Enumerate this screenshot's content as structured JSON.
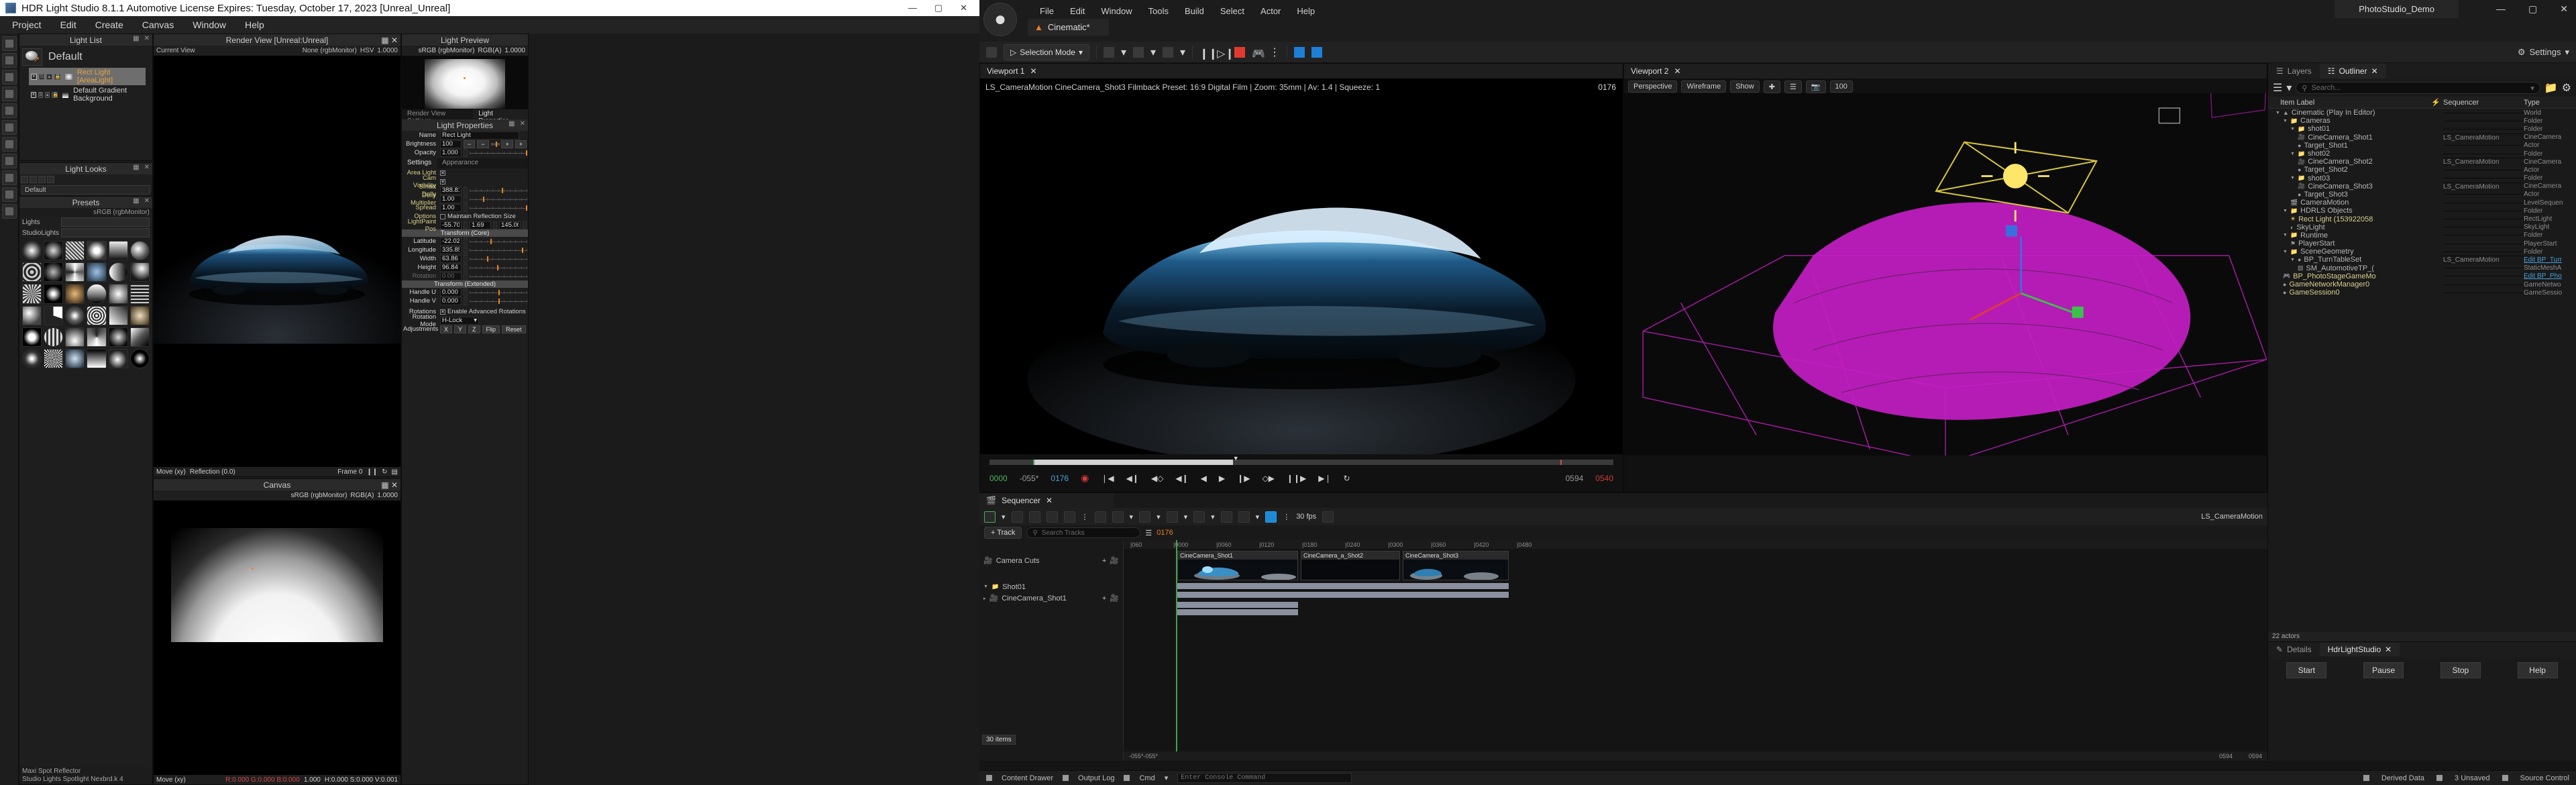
{
  "hdrls": {
    "title": "HDR Light Studio 8.1.1  Automotive License Expires: Tuesday, October 17, 2023  [Unreal_Unreal]",
    "window_buttons": [
      "—",
      "▢",
      "✕"
    ],
    "menu": [
      "Project",
      "Edit",
      "Create",
      "Canvas",
      "Window",
      "Help"
    ],
    "light_list": {
      "title": "Light List",
      "default_label": "Default",
      "items": [
        {
          "name": "Rect Light [AreaLight]",
          "selected": true
        },
        {
          "name": "Default Gradient Background",
          "selected": false
        }
      ]
    },
    "light_looks": {
      "title": "Light Looks",
      "slot": "Default"
    },
    "presets": {
      "title": "Presets",
      "colorspace": "sRGB (rgbMonitor)",
      "rows": [
        {
          "label": "Lights",
          "value": ""
        },
        {
          "label": "StudioLights",
          "value": ""
        }
      ],
      "footer_lines": [
        "Maxi Spot Reflector",
        "Studio Lights Spotlight Nexbrd.k 4"
      ]
    },
    "render_view": {
      "title": "Render View [Unreal:Unreal]",
      "bar_left": "Current View",
      "bar_mid": "None (rgbMonitor)",
      "bar_color": "HSV",
      "bar_value": "1.0000",
      "foot_move": "Move (xy)",
      "foot_reflect": "Reflection (0.0)",
      "foot_frame": "Frame 0"
    },
    "canvas": {
      "title": "Canvas",
      "colorspace": "sRGB (rgbMonitor)",
      "value": "1.0000",
      "foot_move": "Move (xy)",
      "readout_left": "R:0.000 G:0.000 B:0.000",
      "readout_exp": "1.000",
      "readout_right": "H:0.000 S:0.000 V:0.001"
    },
    "light_preview": {
      "title": "Light Preview",
      "colorspace": "sRGB (rgbMonitor)",
      "channel": "RGB(A)",
      "value": "1.0000"
    },
    "light_properties": {
      "tabs": [
        "Render View Settings",
        "Light Properties"
      ],
      "active_tab": "Light Properties",
      "panel_title": "Light Properties",
      "name_label": "Name",
      "name_value": "Rect Light",
      "brightness_label": "Brightness",
      "brightness_value": "100",
      "opacity_label": "Opacity",
      "opacity_value": "1.000",
      "sub_tabs": [
        "Settings",
        "Appearance"
      ],
      "sub_active": "Settings",
      "settings": [
        {
          "label": "Area Light",
          "type": "check",
          "checked": true
        },
        {
          "label": "Cam Visibility",
          "type": "check",
          "checked": true
        },
        {
          "label": "Smart Dolly",
          "type": "slider",
          "value": "388.81",
          "knob": 57
        },
        {
          "label": "Dolly Multiplier",
          "type": "slider",
          "value": "1.00",
          "knob": 24
        },
        {
          "label": "Spread",
          "type": "slider",
          "value": "1.00",
          "knob": 99
        }
      ],
      "options_label": "Options",
      "options_check": "Maintain Reflection Size",
      "options_checked": false,
      "lightpaint_label": "LightPaint Pos",
      "lightpaint": [
        "-55.70",
        "1.69",
        "145.00"
      ],
      "transform_core_title": "Transform (Core)",
      "transform_core": [
        {
          "label": "Latitude",
          "value": "-22.02",
          "knob": 37
        },
        {
          "label": "Longitude",
          "value": "335.85",
          "knob": 92
        },
        {
          "label": "Width",
          "value": "63.86",
          "knob": 31
        },
        {
          "label": "Height",
          "value": "96.84",
          "knob": 48
        },
        {
          "label": "Rotation",
          "value": "0.00",
          "knob": 0,
          "disabled": true
        }
      ],
      "transform_ext_title": "Transform (Extended)",
      "transform_ext": [
        {
          "label": "Handle U",
          "value": "0.000",
          "knob": 50
        },
        {
          "label": "Handle V",
          "value": "0.000",
          "knob": 50
        }
      ],
      "rotations_label": "Rotations",
      "rotations_check": "Enable Advanced Rotations",
      "rotations_checked": true,
      "rotation_mode_label": "Rotation Mode",
      "rotation_mode_value": "H-Lock",
      "adjustments_label": "Adjustments",
      "adjust_buttons": [
        "X",
        "Y",
        "Z",
        "Flip",
        "Reset"
      ]
    }
  },
  "unreal": {
    "menu": [
      "File",
      "Edit",
      "Window",
      "Tools",
      "Build",
      "Select",
      "Actor",
      "Help"
    ],
    "tab_label": "Cinematic*",
    "project_tab": "PhotoStudio_Demo",
    "window_buttons": [
      "—",
      "▢",
      "✕"
    ],
    "toolbar": {
      "selection_mode": "Selection Mode",
      "settings": "Settings"
    },
    "viewports": [
      {
        "tab": "Viewport 1",
        "stats": "LS_CameraMotion CineCamera_Shot3  Filmback Preset: 16:9 Digital Film | Zoom: 35mm | Av: 1.4 | Squeeze: 1",
        "frame": "0176",
        "timeline": {
          "start": "0000",
          "offset": "-055*",
          "current": "0176",
          "end_grey": "0594",
          "end_red": "0540"
        }
      },
      {
        "tab": "Viewport 2",
        "chips": [
          "Perspective",
          "Wireframe",
          "Show"
        ],
        "fov": "100"
      }
    ],
    "outliner": {
      "tabs": [
        "Layers",
        "Outliner"
      ],
      "active_tab": "Outliner",
      "search_placeholder": "Search...",
      "columns": [
        "Item Label",
        "Sequencer",
        "Type"
      ],
      "rows": [
        {
          "indent": 1,
          "icon": "world-icon",
          "label": "Cinematic (Play In Editor)",
          "seq": "",
          "type": "World",
          "expand": true
        },
        {
          "indent": 2,
          "icon": "folder-icon",
          "label": "Cameras",
          "seq": "",
          "type": "Folder",
          "expand": true
        },
        {
          "indent": 3,
          "icon": "folder-icon",
          "label": "shot01",
          "seq": "",
          "type": "Folder",
          "expand": true
        },
        {
          "indent": 4,
          "icon": "camera-icon",
          "label": "CineCamera_Shot1",
          "seq": "LS_CameraMotion",
          "type": "CineCamera"
        },
        {
          "indent": 4,
          "icon": "actor-icon",
          "label": "Target_Shot1",
          "seq": "",
          "type": "Actor"
        },
        {
          "indent": 3,
          "icon": "folder-icon",
          "label": "shot02",
          "seq": "",
          "type": "Folder",
          "expand": true
        },
        {
          "indent": 4,
          "icon": "camera-icon",
          "label": "CineCamera_Shot2",
          "seq": "LS_CameraMotion",
          "type": "CineCamera"
        },
        {
          "indent": 4,
          "icon": "actor-icon",
          "label": "Target_Shot2",
          "seq": "",
          "type": "Actor"
        },
        {
          "indent": 3,
          "icon": "folder-icon",
          "label": "shot03",
          "seq": "",
          "type": "Folder",
          "expand": true
        },
        {
          "indent": 4,
          "icon": "camera-icon",
          "label": "CineCamera_Shot3",
          "seq": "LS_CameraMotion",
          "type": "CineCamera"
        },
        {
          "indent": 4,
          "icon": "actor-icon",
          "label": "Target_Shot3",
          "seq": "",
          "type": "Actor"
        },
        {
          "indent": 3,
          "icon": "clapper-icon",
          "label": "CameraMotion",
          "seq": "",
          "type": "LevelSequen"
        },
        {
          "indent": 2,
          "icon": "folder-icon",
          "label": "HDRLS Objects",
          "seq": "",
          "type": "Folder",
          "expand": true
        },
        {
          "indent": 3,
          "icon": "light-icon",
          "label": "Rect Light (153922058",
          "seq": "",
          "type": "RectLight",
          "hl": true
        },
        {
          "indent": 3,
          "icon": "skylight-icon",
          "label": "SkyLight",
          "seq": "",
          "type": "SkyLight"
        },
        {
          "indent": 2,
          "icon": "folder-icon",
          "label": "Runtime",
          "seq": "",
          "type": "Folder",
          "expand": true
        },
        {
          "indent": 3,
          "icon": "flag-icon",
          "label": "PlayerStart",
          "seq": "",
          "type": "PlayerStart"
        },
        {
          "indent": 2,
          "icon": "folder-icon",
          "label": "SceneGeometry",
          "seq": "",
          "type": "Folder",
          "expand": true
        },
        {
          "indent": 3,
          "icon": "actor-icon",
          "label": "BP_TurnTableSet",
          "seq": "LS_CameraMotion",
          "type": "Edit BP_Turr",
          "link": true,
          "expand": true
        },
        {
          "indent": 4,
          "icon": "mesh-icon",
          "label": "SM_AutomotiveTP_(",
          "seq": "",
          "type": "StaticMeshA"
        },
        {
          "indent": 2,
          "icon": "gamepad-icon",
          "label": "BP_PhotoStageGameMo",
          "seq": "",
          "type": "Edit BP_Pho",
          "link": true,
          "hl": true
        },
        {
          "indent": 2,
          "icon": "actor-icon",
          "label": "GameNetworkManager0",
          "seq": "",
          "type": "GameNetwo",
          "hl": true
        },
        {
          "indent": 2,
          "icon": "actor-icon",
          "label": "GameSession0",
          "seq": "",
          "type": "GameSessio",
          "hl": true
        }
      ],
      "footer": "22 actors"
    },
    "details": {
      "tabs": [
        "Details",
        "HdrLightStudio"
      ],
      "active_tab": "HdrLightStudio",
      "buttons": [
        "Start",
        "Pause",
        "Stop",
        "Help"
      ]
    },
    "sequencer": {
      "tab": "Sequencer",
      "fps": "30 fps",
      "title_right": "LS_CameraMotion",
      "track_button": "+ Track",
      "search_placeholder": "Search Tracks",
      "frame": "0176",
      "items_tooltip": "30 items",
      "tracks": [
        {
          "label": "Camera Cuts",
          "icon": "camera-cut-icon"
        },
        {
          "label": "Shot01",
          "icon": "folder-icon"
        },
        {
          "label": "CineCamera_Shot1",
          "icon": "camera-icon"
        }
      ],
      "ruler_labels": [
        "060",
        "0000",
        "0060",
        "0120",
        "0180",
        "0240",
        "0300",
        "0360",
        "0420",
        "0480"
      ],
      "shots": [
        {
          "label": "CineCamera_Shot1"
        },
        {
          "label": "CineCamera_a_Shot2"
        },
        {
          "label": "CineCamera_Shot3"
        }
      ],
      "timecodes_left": [
        "-055*",
        "-055*"
      ],
      "timecodes_right": [
        "0594",
        "0594"
      ]
    },
    "status_bar": {
      "content_drawer": "Content Drawer",
      "output_log": "Output Log",
      "cmd": "Cmd",
      "console_placeholder": "Enter Console Command",
      "derived_data": "Derived Data",
      "unsaved": "3 Unsaved",
      "source_control": "Source Control"
    }
  }
}
